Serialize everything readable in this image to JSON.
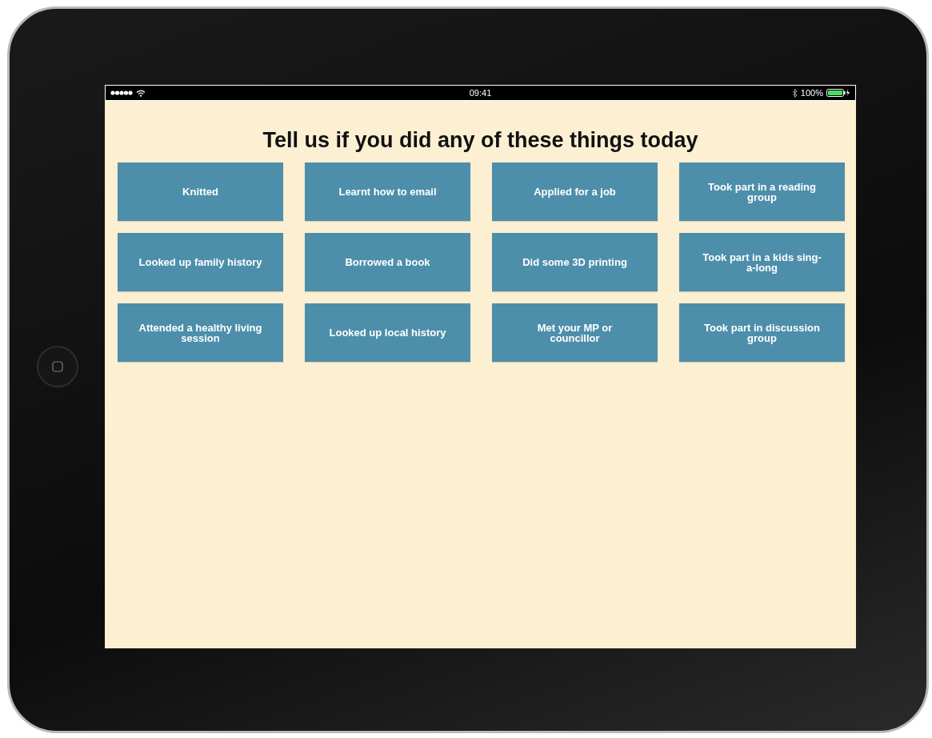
{
  "status_bar": {
    "time": "09:41",
    "battery": "100%"
  },
  "title": "Tell us if you did any of these things today",
  "activities": [
    {
      "label": "Knitted"
    },
    {
      "label": "Learnt how to email"
    },
    {
      "label": "Applied for a job"
    },
    {
      "label": "Took part in a reading group"
    },
    {
      "label": "Looked up family history"
    },
    {
      "label": "Borrowed a book"
    },
    {
      "label": "Did some 3D printing"
    },
    {
      "label": "Took part in a kids sing-a-long"
    },
    {
      "label": "Attended a healthy living session"
    },
    {
      "label": "Looked up local history"
    },
    {
      "label": "Met your MP or councillor"
    },
    {
      "label": "Took part in discussion group"
    }
  ]
}
